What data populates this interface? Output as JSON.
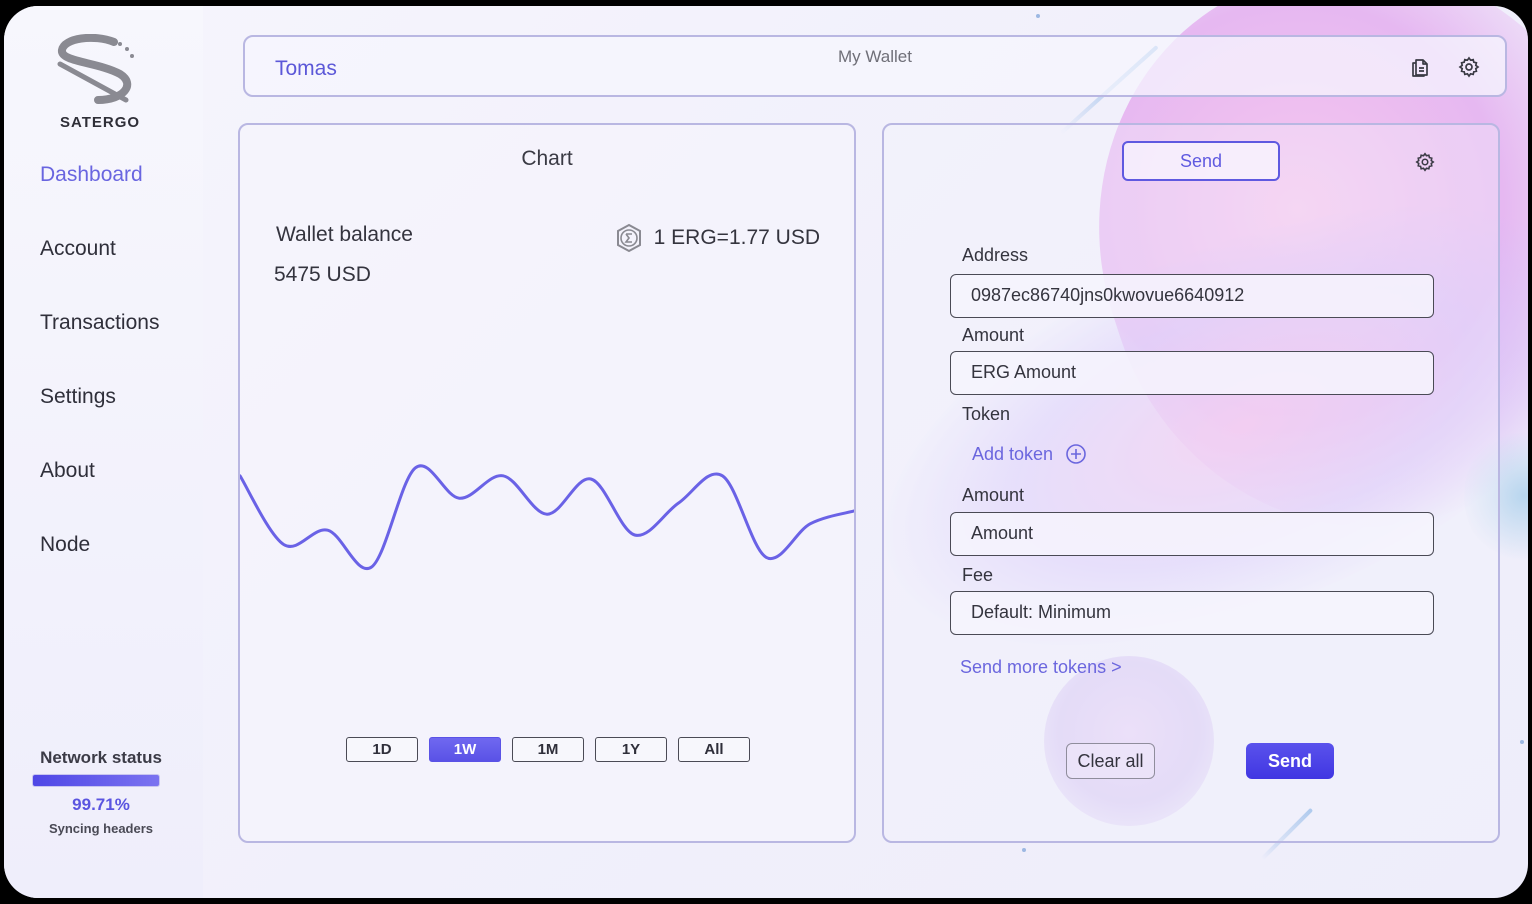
{
  "app": {
    "brand": "SATERGO"
  },
  "sidebar": {
    "items": [
      {
        "label": "Dashboard",
        "active": true
      },
      {
        "label": "Account"
      },
      {
        "label": "Transactions"
      },
      {
        "label": "Settings"
      },
      {
        "label": "About"
      },
      {
        "label": "Node"
      }
    ],
    "network": {
      "title": "Network status",
      "percent": "99.71%",
      "progress_fraction": 0.9971,
      "status": "Syncing headers"
    }
  },
  "header": {
    "user": "Tomas",
    "wallet_title": "My Wallet",
    "icons": [
      "copy-icon",
      "gear-icon"
    ]
  },
  "chart": {
    "title": "Chart",
    "balance_label": "Wallet balance",
    "balance_value": "5475 USD",
    "rate": "1 ERG=1.77 USD",
    "ranges": [
      "1D",
      "1W",
      "1M",
      "1Y",
      "All"
    ],
    "active_range": "1W"
  },
  "send_form": {
    "tab_label": "Send",
    "address_label": "Address",
    "address_value": "0987ec86740jns0kwovue6640912",
    "amount_label": "Amount",
    "amount_value": "ERG Amount",
    "token_label": "Token",
    "add_token_label": "Add token",
    "token_amount_label": "Amount",
    "token_amount_value": "Amount",
    "fee_label": "Fee",
    "fee_value": "Default: Minimum",
    "more_link": "Send more tokens >",
    "clear_label": "Clear all",
    "send_label": "Send"
  },
  "colors": {
    "accent": "#6965e0",
    "button": "#4a40e6",
    "chart_line": "#6a62e6"
  },
  "chart_data": {
    "type": "line",
    "title": "Chart",
    "series": [
      {
        "values": [
          0.62,
          0.19,
          0.28,
          0.05,
          0.67,
          0.48,
          0.62,
          0.38,
          0.6,
          0.25,
          0.45,
          0.62,
          0.11,
          0.32,
          0.4
        ]
      }
    ],
    "xlabel": "",
    "ylabel": "",
    "grid": false,
    "legend": "none"
  }
}
